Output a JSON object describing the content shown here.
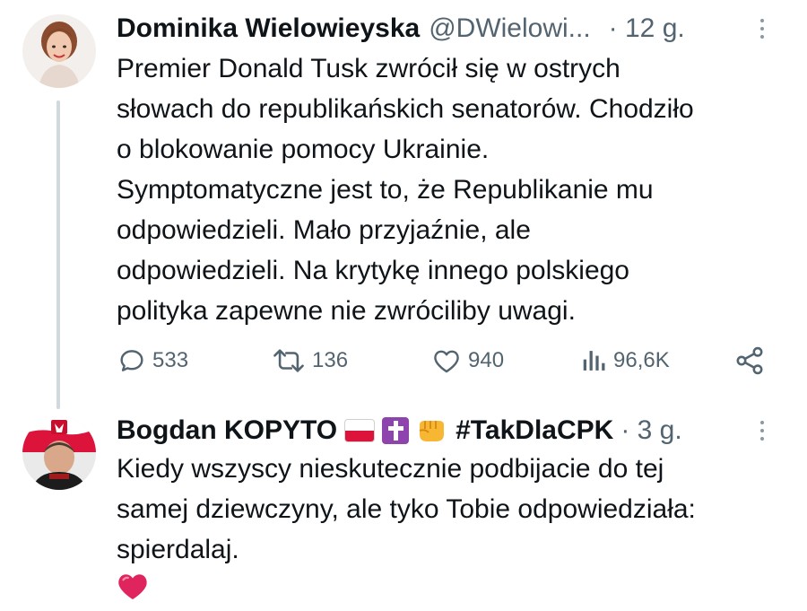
{
  "tweets": [
    {
      "author_name": "Dominika Wielowieyska",
      "handle": "@DWielowi...",
      "time": "· 12 g.",
      "text": "Premier Donald Tusk zwrócił się w ostrych\nsłowach do republikańskich senatorów. Chodziło\no blokowanie pomocy Ukrainie.\nSymptomatyczne jest to, że Republikanie mu\nodpowiedzieli. Mało przyjaźnie, ale\nodpowiedzieli. Na krytykę innego polskiego\npolityka zapewne nie zwróciliby uwagi.",
      "actions": {
        "replies": "533",
        "retweets": "136",
        "likes": "940",
        "views": "96,6K"
      }
    },
    {
      "author_name": "Bogdan KOPYTO",
      "name_emojis": [
        "flag-poland-icon",
        "latin-cross-icon",
        "fist-icon"
      ],
      "hashtag": "#TakDlaCPK",
      "time": "· 3 g.",
      "text": "Kiedy wszyscy nieskutecznie podbijacie do tej\nsamej dziewczyny, ale tyko Tobie odpowiedziała:\nspierdalaj.",
      "trailing_emoji": "red-heart-icon"
    }
  ],
  "colors": {
    "text": "#0f1419",
    "secondary": "#536471",
    "thread_line": "#cfd9de",
    "heart": "#e0245e"
  }
}
